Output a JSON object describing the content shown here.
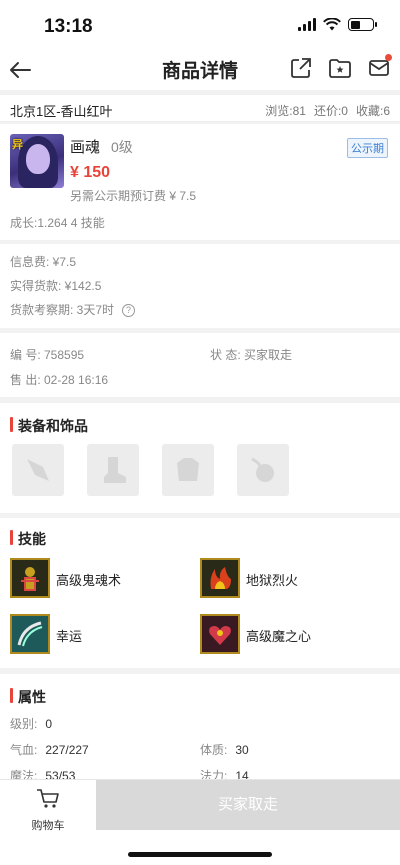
{
  "status": {
    "time": "13:18"
  },
  "nav": {
    "title": "商品详情"
  },
  "server": {
    "name": "北京1区-香山红叶",
    "views": "浏览:81",
    "bargain": "还价:0",
    "favorites": "收藏:6"
  },
  "pet": {
    "badge": "异",
    "name": "画魂",
    "level": "0级",
    "tag": "公示期",
    "price": "¥ 150",
    "deposit": "另需公示期预订费 ¥ 7.5",
    "growth": "成长:1.264 4 技能"
  },
  "fees": {
    "info_fee": "信息费: ¥7.5",
    "received": "实得货款: ¥142.5",
    "review_period": "货款考察期: 3天7时",
    "help_icon": "?"
  },
  "order": {
    "number": "编 号:  758595",
    "status": "状 态:  买家取走",
    "sold": "售 出:  02-28 16:16"
  },
  "equipment": {
    "title": "装备和饰品",
    "slots": [
      "weapon-slot-icon",
      "boot-slot-icon",
      "armor-slot-icon",
      "accessory-slot-icon"
    ]
  },
  "skills": {
    "title": "技能",
    "items": [
      {
        "label": "高级鬼魂术",
        "icon": "ghost-skill-icon"
      },
      {
        "label": "地狱烈火",
        "icon": "hellfire-skill-icon"
      },
      {
        "label": "幸运",
        "icon": "luck-skill-icon"
      },
      {
        "label": "高级魔之心",
        "icon": "magic-heart-skill-icon"
      }
    ]
  },
  "attributes": {
    "title": "属性",
    "level_label": "级别:",
    "level_value": "0",
    "hp_label": "气血:",
    "hp_value": "227/227",
    "constitution_label": "体质:",
    "constitution_value": "30",
    "mp_label": "魔法:",
    "mp_value": "53/53",
    "power_label": "法力:",
    "power_value": "14"
  },
  "bottom": {
    "cart_label": "购物车",
    "buy_label": "买家取走"
  },
  "colors": {
    "accent": "#e8443a",
    "tag_blue": "#3b7fd6",
    "disabled": "#d9d9d9"
  }
}
